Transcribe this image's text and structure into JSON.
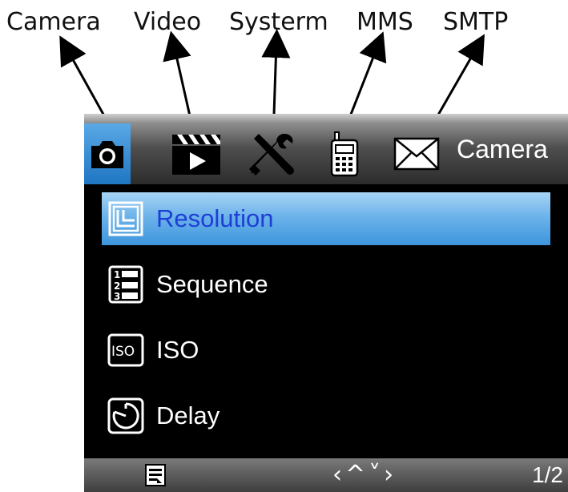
{
  "annotations": {
    "camera": "Camera",
    "video": "Video",
    "system": "Systerm",
    "mms": "MMS",
    "smtp": "SMTP"
  },
  "tabs": [
    {
      "name": "Camera",
      "icon": "camera-icon",
      "active": true
    },
    {
      "name": "Video",
      "icon": "clapperboard-icon",
      "active": false
    },
    {
      "name": "System",
      "icon": "wrench-screwdriver-icon",
      "active": false
    },
    {
      "name": "MMS",
      "icon": "phone-icon",
      "active": false
    },
    {
      "name": "SMTP",
      "icon": "envelope-icon",
      "active": false
    }
  ],
  "header": {
    "title": "Camera"
  },
  "menu": {
    "items": [
      {
        "label": "Resolution",
        "icon": "resolution-icon",
        "selected": true
      },
      {
        "label": "Sequence",
        "icon": "sequence-list-icon",
        "selected": false
      },
      {
        "label": "ISO",
        "icon": "iso-icon",
        "selected": false
      },
      {
        "label": "Delay",
        "icon": "timer-icon",
        "selected": false
      }
    ]
  },
  "footer": {
    "note_icon": "note-icon",
    "nav": "‹^˅›",
    "page": "1/2"
  },
  "colors": {
    "accent": "#1f76c2",
    "selected_text": "#1d3fd6",
    "screen_bg": "#000000"
  }
}
